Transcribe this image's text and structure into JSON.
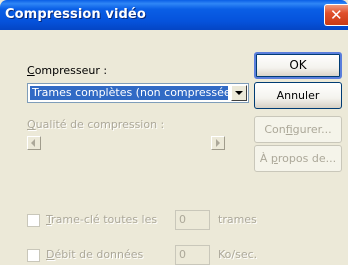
{
  "window": {
    "title": "Compression vidéo"
  },
  "compressor": {
    "label_prefix": "",
    "label_accel": "C",
    "label_rest": "ompresseur :",
    "selected": "Trames complètes (non compressées)"
  },
  "quality": {
    "label_accel": "Q",
    "label_rest": "ualité de compression :"
  },
  "buttons": {
    "ok": "OK",
    "cancel": "Annuler",
    "configure_pre": "Con",
    "configure_accel": "f",
    "configure_post": "igurer...",
    "about_pre": "À ",
    "about_accel": "p",
    "about_post": "ropos de..."
  },
  "keyframe": {
    "label_accel": "T",
    "label_rest": "rame-clé toutes les",
    "value": "0",
    "unit": "trames",
    "checked": false
  },
  "datarate": {
    "label_accel": "D",
    "label_rest": "ébit de données",
    "value": "0",
    "unit": "Ko/sec.",
    "checked": false
  }
}
